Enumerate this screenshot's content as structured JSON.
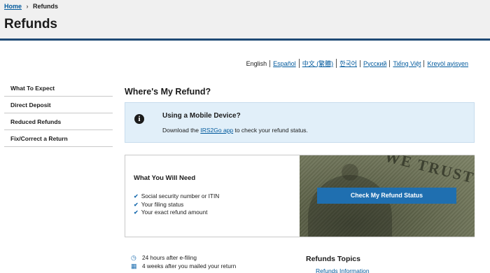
{
  "breadcrumb": {
    "home": "Home",
    "separator": "›",
    "current": "Refunds"
  },
  "page": {
    "title": "Refunds",
    "section_title": "Where's My Refund?"
  },
  "languages": [
    "English",
    "Español",
    "中文 (繁體)",
    "한국어",
    "Русский",
    "Tiếng Việt",
    "Kreyòl ayisyen"
  ],
  "sidenav": {
    "items": [
      "What To Expect",
      "Direct Deposit",
      "Reduced Refunds",
      "Fix/Correct a Return"
    ]
  },
  "mobile": {
    "title": "Using a Mobile Device?",
    "text_before": "Download the ",
    "link": "IRS2Go app",
    "text_after": " to check your refund status."
  },
  "need": {
    "title": "What You Will Need",
    "items": [
      "Social security number or ITIN",
      "Your filing status",
      "Your exact refund amount"
    ]
  },
  "cta": {
    "label": "Check My Refund Status"
  },
  "image": {
    "motto": "WE TRUST"
  },
  "timeline": {
    "items": [
      {
        "icon": "clock-icon",
        "text": "24 hours after e-filing"
      },
      {
        "icon": "calendar-icon",
        "text": "4 weeks after you mailed your return"
      }
    ]
  },
  "topics": {
    "title": "Refunds Topics",
    "first_item": "Refunds Information"
  },
  "colors": {
    "primary_blue": "#1f6fb0",
    "header_border": "#1f4a75",
    "link": "#00599c",
    "info_bg": "#e1eff9"
  }
}
